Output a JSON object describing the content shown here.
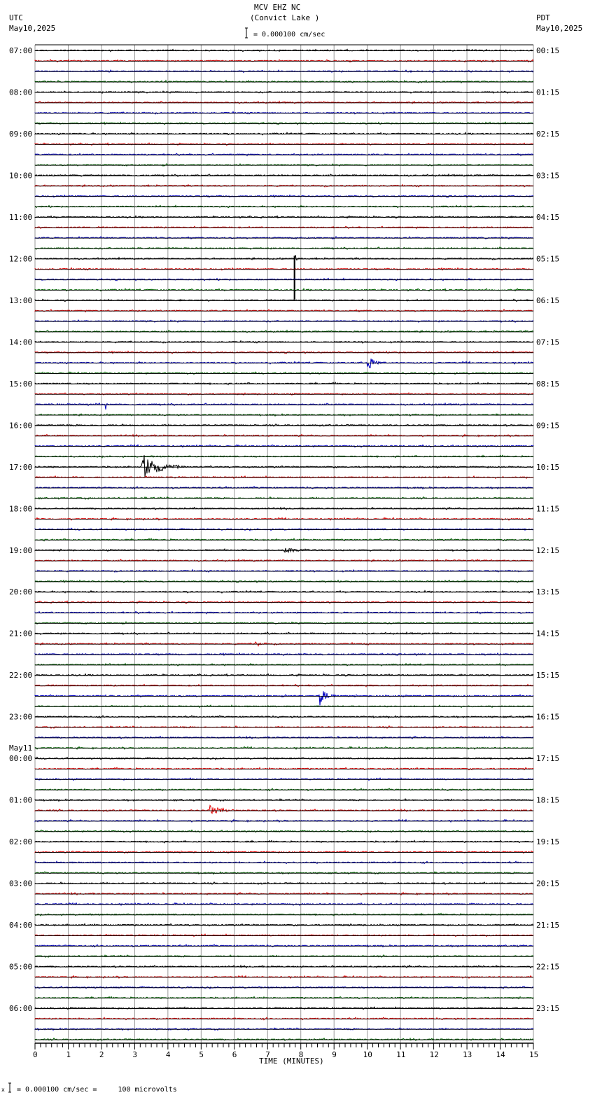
{
  "header": {
    "station": "MCV EHZ NC",
    "location": "(Convict Lake )",
    "left_tz": "UTC",
    "left_date": "May10,2025",
    "right_tz": "PDT",
    "right_date": "May10,2025",
    "scale": "= 0.000100 cm/sec"
  },
  "footer": {
    "scale_note": "= 0.000100 cm/sec =     100 microvolts",
    "marker": "x"
  },
  "chart_data": {
    "type": "line",
    "title": "MCV EHZ NC (Convict Lake )",
    "xlabel": "TIME (MINUTES)",
    "xlim": [
      0,
      15
    ],
    "x_ticks": [
      "0",
      "1",
      "2",
      "3",
      "4",
      "5",
      "6",
      "7",
      "8",
      "9",
      "10",
      "11",
      "12",
      "13",
      "14",
      "15"
    ],
    "traces_per_hour": 4,
    "trace_count": 96,
    "trace_colors": [
      "#000000",
      "#e00000",
      "#0000c0",
      "#006400"
    ],
    "left_labels": [
      "07:00",
      "08:00",
      "09:00",
      "10:00",
      "11:00",
      "12:00",
      "13:00",
      "14:00",
      "15:00",
      "16:00",
      "17:00",
      "18:00",
      "19:00",
      "20:00",
      "21:00",
      "22:00",
      "23:00",
      "00:00",
      "01:00",
      "02:00",
      "03:00",
      "04:00",
      "05:00",
      "06:00"
    ],
    "date_change": {
      "hour_index": 17,
      "label": "May11"
    },
    "right_labels": [
      "00:15",
      "01:15",
      "02:15",
      "03:15",
      "04:15",
      "05:15",
      "06:15",
      "07:15",
      "08:15",
      "09:15",
      "10:15",
      "11:15",
      "12:15",
      "13:15",
      "14:15",
      "15:15",
      "16:15",
      "17:15",
      "18:15",
      "19:15",
      "20:15",
      "21:15",
      "22:15",
      "23:15"
    ],
    "events": [
      {
        "trace": 20,
        "minute": 7.8,
        "duration": 0.08,
        "amplitude": 60,
        "color": "#000000"
      },
      {
        "trace": 30,
        "minute": 10.0,
        "duration": 0.6,
        "amplitude": 12
      },
      {
        "trace": 34,
        "minute": 2.12,
        "duration": 0.05,
        "amplitude": 12
      },
      {
        "trace": 35,
        "minute": 2.9,
        "duration": 0.05,
        "amplitude": 5
      },
      {
        "trace": 40,
        "minute": 3.2,
        "duration": 1.3,
        "amplitude": 22
      },
      {
        "trace": 48,
        "minute": 7.5,
        "duration": 1.4,
        "amplitude": 4
      },
      {
        "trace": 56,
        "minute": 6.98,
        "duration": 0.08,
        "amplitude": 14
      },
      {
        "trace": 57,
        "minute": 6.6,
        "duration": 0.5,
        "amplitude": 6
      },
      {
        "trace": 62,
        "minute": 8.55,
        "duration": 0.6,
        "amplitude": 16
      },
      {
        "trace": 73,
        "minute": 5.25,
        "duration": 0.9,
        "amplitude": 9
      }
    ]
  }
}
